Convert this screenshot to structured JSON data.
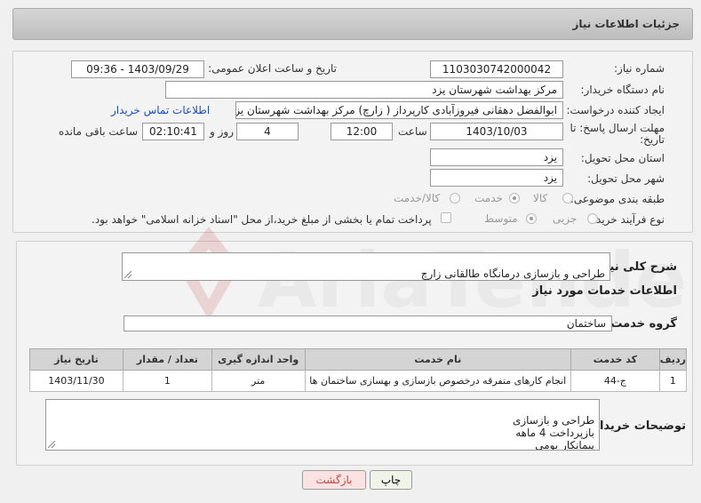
{
  "header": {
    "title": "جزئیات اطلاعات نیاز"
  },
  "fields": {
    "need_number": {
      "label": "شماره نیاز:",
      "value": "1103030742000042"
    },
    "announce_datetime": {
      "label": "تاریخ و ساعت اعلان عمومی:",
      "value": "1403/09/29 - 09:36"
    },
    "buyer_org": {
      "label": "نام دستگاه خریدار:",
      "value": "مرکز بهداشت شهرستان یزد"
    },
    "requester": {
      "label": "ایجاد کننده درخواست:",
      "value": "ابوالفضل دهقانی فیروزآبادی کارپرداز ( زارچ) مرکز بهداشت شهرستان یزد"
    },
    "buyer_contact_link": "اطلاعات تماس خریدار",
    "deadline": {
      "label_line1": "مهلت ارسال پاسخ: تا",
      "label_line2": "تاریخ:",
      "date": "1403/10/03",
      "time_label": "ساعت",
      "time": "12:00",
      "days": "4",
      "days_label": "روز و",
      "remaining": "02:10:41",
      "remaining_label": "ساعت باقی مانده"
    },
    "delivery_province": {
      "label": "استان محل تحویل:",
      "value": "یزد"
    },
    "delivery_city": {
      "label": "شهر محل تحویل:",
      "value": "یزد"
    },
    "category": {
      "label": "طبقه بندی موضوعی:",
      "options": [
        "کالا",
        "خدمت",
        "کالا/خدمت"
      ],
      "selected": "خدمت"
    },
    "purchase_type": {
      "label": "نوع فرآیند خرید :",
      "options": [
        "جزیی",
        "متوسط"
      ],
      "selected": "متوسط",
      "treasury_note": "پرداخت تمام یا بخشی از مبلغ خرید،از محل \"اسناد خزانه اسلامی\" خواهد بود."
    }
  },
  "summary": {
    "label": "شرح کلی نیاز:",
    "value": "طراحی و بازسازی درمانگاه طالقانی زارچ"
  },
  "services_section": {
    "title": "اطلاعات خدمات مورد نیاز",
    "group_label": "گروه خدمت:",
    "group_value": "ساختمان",
    "table": {
      "headers": [
        "ردیف",
        "کد خدمت",
        "نام خدمت",
        "واحد اندازه گیری",
        "تعداد / مقدار",
        "تاریخ نیاز"
      ],
      "rows": [
        [
          "1",
          "ج-44",
          "انجام کارهای متفرقه درخصوص بازسازی و بهسازی ساختمان ها",
          "متر",
          "1",
          "1403/11/30"
        ]
      ]
    },
    "buyer_notes_label": "توضیحات خریدار:",
    "buyer_notes": "طراحی و بازسازی\nبازپرداخت 4 ماهه\nپیمانکار بومی\nاعلام قیمت بعد از بازدید حضوری"
  },
  "buttons": {
    "print": "چاپ",
    "back": "بازگشت"
  },
  "colors": {
    "link": "#1a4fc0",
    "back_button_bg": "#fbe3e3",
    "print_button_bg": "#eef5e8"
  },
  "watermark_text": "AriaTender.net"
}
